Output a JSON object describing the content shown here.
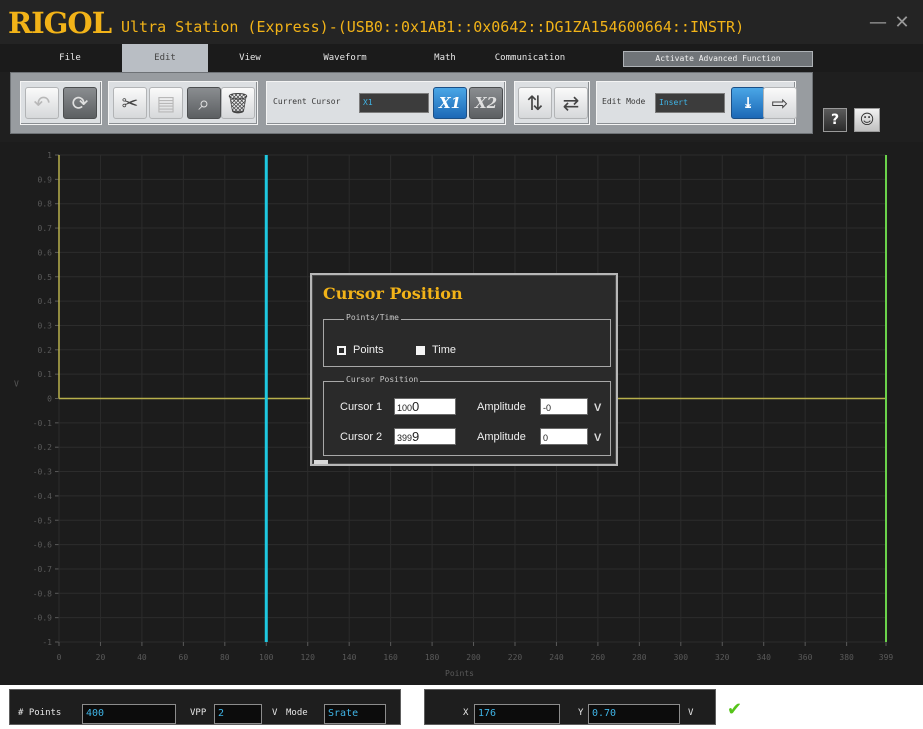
{
  "titlebar": {
    "logo": "RIGOL",
    "title": "Ultra Station (Express)-(USB0::0x1AB1::0x0642::DG1ZA154600664::INSTR)",
    "minimize": "—",
    "close": "✕"
  },
  "menu": {
    "file": "File",
    "edit": "Edit",
    "view": "View",
    "waveform": "Waveform",
    "math": "Math",
    "communication": "Communication",
    "activate": "Activate Advanced Function"
  },
  "toolbar": {
    "current_cursor_label": "Current Cursor",
    "current_cursor_value": "X1",
    "x1_label": "X1",
    "x2_label": "X2",
    "edit_mode_label": "Edit Mode",
    "edit_mode_value": "Insert",
    "help_icon": "?"
  },
  "plot": {
    "y_axis_label": "V",
    "x_axis_label": "Points",
    "y_ticks": [
      "1",
      "0.9",
      "0.8",
      "0.7",
      "0.6",
      "0.5",
      "0.4",
      "0.3",
      "0.2",
      "0.1",
      "0",
      "-0.1",
      "-0.2",
      "-0.3",
      "-0.4",
      "-0.5",
      "-0.6",
      "-0.7",
      "-0.8",
      "-0.9",
      "-1"
    ],
    "x_ticks": [
      "0",
      "20",
      "40",
      "60",
      "80",
      "100",
      "120",
      "140",
      "160",
      "180",
      "200",
      "220",
      "240",
      "260",
      "280",
      "300",
      "320",
      "340",
      "360",
      "380",
      "399"
    ],
    "x_range": [
      0,
      399
    ],
    "y_range": [
      -1,
      1
    ],
    "cursor1_point": 100,
    "cursor2_point": 399,
    "waveform_level": 0,
    "colors": {
      "background": "#1c1c1c",
      "grid": "#2c2c2c",
      "waveform": "#b8b04c",
      "cursor1": "#1ec8e0",
      "cursor2": "#6ad24a",
      "ticks": "#5a5a5a"
    }
  },
  "dialog": {
    "title": "Cursor Position",
    "points_time_legend": "Points/Time",
    "points_label": "Points",
    "time_label": "Time",
    "selected_unit": "Points",
    "cursor_position_legend": "Cursor Position",
    "cursor1_label": "Cursor 1",
    "cursor1_value_prefix": "100",
    "cursor1_value_suffix": "0",
    "cursor2_label": "Cursor 2",
    "cursor2_value_prefix": "399",
    "cursor2_value_suffix": "9",
    "amplitude_label": "Amplitude",
    "amplitude1_value": "-0",
    "amplitude2_value": "0",
    "unit": "V"
  },
  "status": {
    "points_label": "# Points",
    "points_value": "400",
    "vpp_label": "VPP",
    "vpp_value": "2",
    "vpp_unit": "V",
    "mode_label": "Mode",
    "mode_value": "Srate",
    "x_label": "X",
    "x_value": "176",
    "y_label": "Y",
    "y_value": "0.70",
    "y_unit": "V",
    "ok_icon": "✔"
  }
}
